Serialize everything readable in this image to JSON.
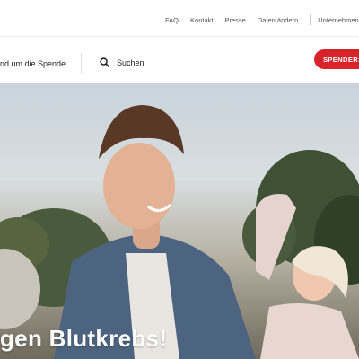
{
  "top_nav": {
    "faq": "FAQ",
    "contact": "Kontakt",
    "press": "Presse",
    "update_data": "Daten ändern",
    "companies": "Unternehmen, Sch"
  },
  "main_nav": {
    "donation_menu": "nd um die Spende",
    "search_label": "Suchen",
    "cta_label": "SPENDER:IN"
  },
  "hero": {
    "headline": "gen Blutkrebs!"
  },
  "colors": {
    "brand_red": "#d9232b"
  },
  "icons": {
    "search": "search-icon"
  }
}
